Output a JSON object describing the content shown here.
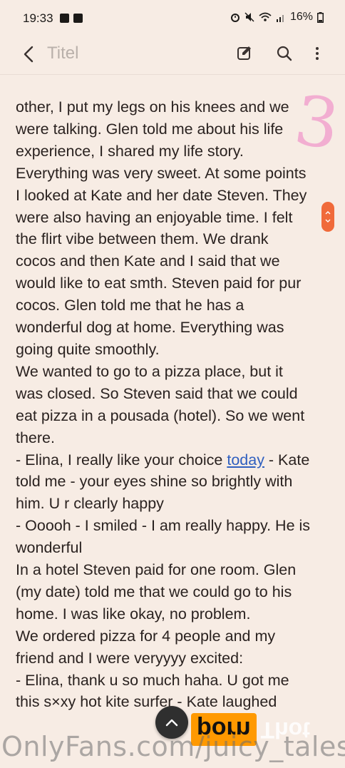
{
  "status": {
    "time": "19:33",
    "battery": "16%"
  },
  "toolbar": {
    "title_placeholder": "Titel"
  },
  "note": {
    "page_number": "3",
    "lines": [
      "other, I put my legs on his knees and we",
      "were talking. Glen told me about his life",
      "experience, I shared my life story.",
      "Everything was very sweet. At some points",
      "I looked at Kate and her date Steven. They",
      "were also having an enjoyable time. I felt",
      "the flirt vibe between them. We drank",
      "cocos and then Kate and I said that we",
      "would like to eat smth. Steven paid for pur",
      "cocos. Glen told me that he has a",
      "wonderful dog at home. Everything was",
      "going quite smoothly.",
      "We wanted to go to a pizza place, but it",
      "was closed. So Steven said that we could",
      "eat pizza in a pousada (hotel). So we went",
      "there."
    ],
    "link_line": {
      "before": "- Elina, I really like your choice ",
      "link": "today",
      "after": " - Kate"
    },
    "lines_after": [
      "told me - your eyes shine so brightly with",
      "him. U r clearly happy",
      "- Ooooh - I smiled - I am really happy. He is",
      "wonderful",
      "In a hotel Steven paid for one room. Glen",
      "(my date) told me that we could go to his",
      "home. I was like okay, no problem.",
      "We ordered pizza for 4 people and my",
      "friend and I were veryyyy excited:",
      "- Elina, thank u so much haha. U got me",
      "this s×xy hot kite surfer - Kate laughed"
    ]
  },
  "watermark": {
    "text": "OnlyFans.com/juicy_tales",
    "logo_box": "porn",
    "logo_text": "Thot"
  },
  "colors": {
    "background": "#f7ece4",
    "accent_orange": "#f06a3a",
    "link": "#2f5fbf",
    "page_number_pink": "#f2a8cf"
  }
}
